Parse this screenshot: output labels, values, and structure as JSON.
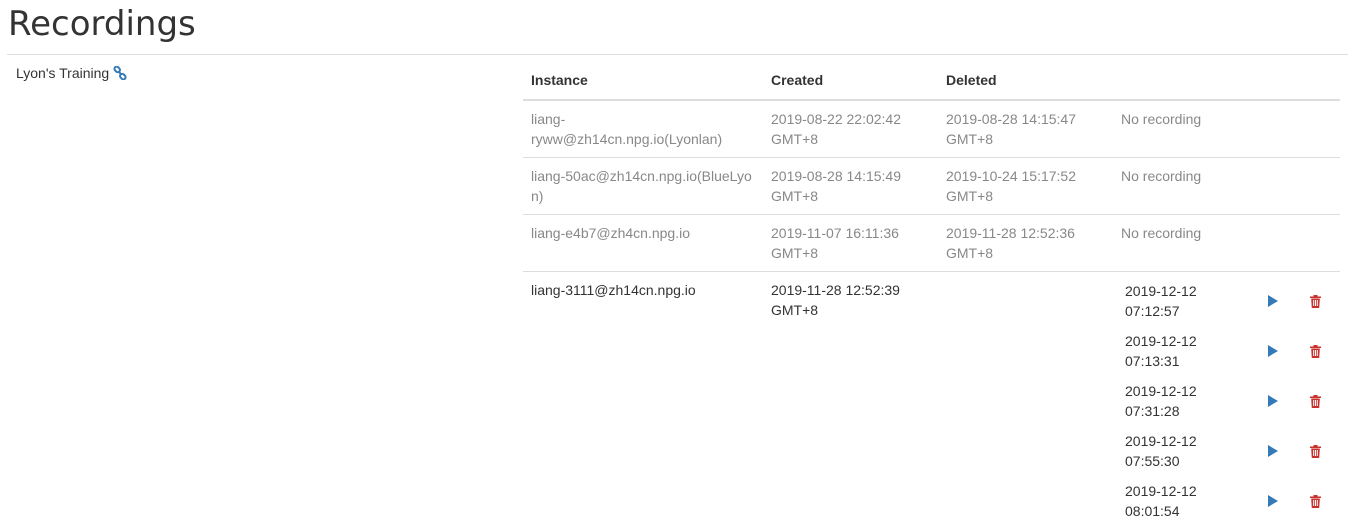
{
  "page": {
    "title": "Recordings"
  },
  "group": {
    "name": "Lyon's Training",
    "link_icon": "link-icon"
  },
  "table": {
    "headers": {
      "instance": "Instance",
      "created": "Created",
      "deleted": "Deleted"
    },
    "rows": [
      {
        "instance": "liang-ryww@zh14cn.npg.io(Lyonlan)",
        "created": "2019-08-22 22:02:42 GMT+8",
        "deleted": "2019-08-28 14:15:47 GMT+8",
        "status": "No recording"
      },
      {
        "instance": "liang-50ac@zh14cn.npg.io(BlueLyon)",
        "created": "2019-08-28 14:15:49 GMT+8",
        "deleted": "2019-10-24 15:17:52 GMT+8",
        "status": "No recording"
      },
      {
        "instance": "liang-e4b7@zh4cn.npg.io",
        "created": "2019-11-07 16:11:36 GMT+8",
        "deleted": "2019-11-28 12:52:36 GMT+8",
        "status": "No recording"
      }
    ],
    "active_row": {
      "instance": "liang-3111@zh14cn.npg.io",
      "created": "2019-11-28 12:52:39 GMT+8",
      "deleted": "",
      "recordings": [
        {
          "time": "2019-12-12 07:12:57"
        },
        {
          "time": "2019-12-12 07:13:31"
        },
        {
          "time": "2019-12-12 07:31:28"
        },
        {
          "time": "2019-12-12 07:55:30"
        },
        {
          "time": "2019-12-12 08:01:54"
        }
      ]
    }
  },
  "icons": {
    "play": "play-icon",
    "delete": "trash-icon"
  },
  "colors": {
    "play": "#337ab7",
    "delete": "#c9302c",
    "link": "#337ab7",
    "muted_text": "#888888",
    "text": "#333333",
    "rule": "#dddddd"
  }
}
